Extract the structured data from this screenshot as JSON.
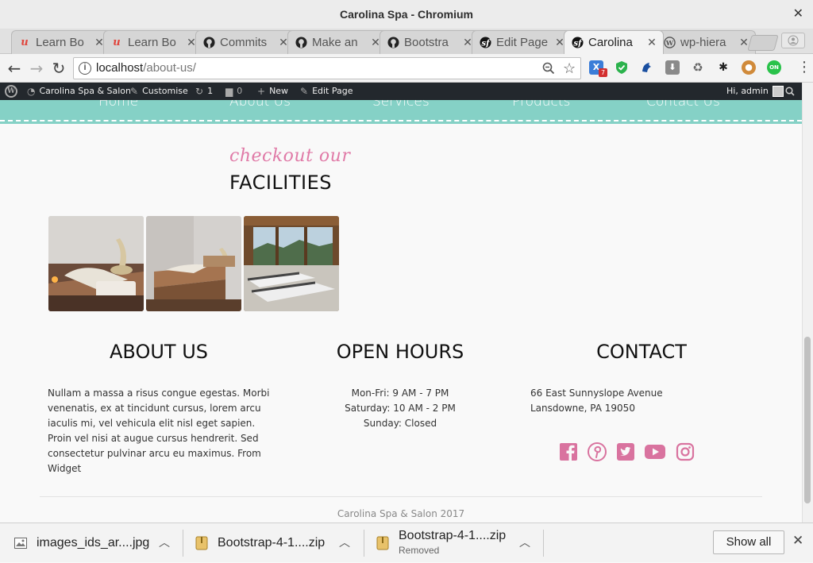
{
  "window": {
    "title": "Carolina Spa - Chromium",
    "close_glyph": "✕"
  },
  "tabs": [
    {
      "label": "Learn Bo",
      "icon": "udemy-icon"
    },
    {
      "label": "Learn Bo",
      "icon": "udemy-icon"
    },
    {
      "label": "Commits",
      "icon": "github-icon"
    },
    {
      "label": "Make an",
      "icon": "github-icon"
    },
    {
      "label": "Bootstra",
      "icon": "github-icon"
    },
    {
      "label": "Edit Page",
      "icon": "symfony-icon"
    },
    {
      "label": "Carolina",
      "icon": "symfony-icon",
      "active": true
    },
    {
      "label": "wp-hiera",
      "icon": "wordpress-icon"
    }
  ],
  "tab_close_glyph": "✕",
  "toolbar": {
    "url_host": "localhost",
    "url_path": "/about-us/",
    "ext_badge": "7"
  },
  "adminbar": {
    "site_name": "Carolina Spa & Salon",
    "customise": "Customise",
    "updates": "1",
    "comments": "0",
    "new": "New",
    "edit_page": "Edit Page",
    "greeting": "Hi, admin"
  },
  "nav": [
    "Home",
    "About Us",
    "Services",
    "Products",
    "Contact Us"
  ],
  "facilities": {
    "script_heading": "checkout our",
    "heading": "FACILITIES"
  },
  "about": {
    "heading": "ABOUT US",
    "text": "Nullam a massa a risus congue egestas. Morbi venenatis, ex at tincidunt cursus, lorem arcu iaculis mi, vel vehicula elit nisl eget sapien. Proin vel nisi at augue cursus hendrerit. Sed consectetur pulvinar arcu eu maximus. From Widget"
  },
  "hours": {
    "heading": "OPEN HOURS",
    "lines": [
      "Mon-Fri: 9 AM - 7 PM",
      "Saturday: 10 AM - 2 PM",
      "Sunday: Closed"
    ]
  },
  "contact": {
    "heading": "CONTACT",
    "address1": "66 East Sunnyslope Avenue",
    "address2": "Lansdowne, PA 19050",
    "social": [
      "facebook-icon",
      "pinterest-icon",
      "twitter-icon",
      "youtube-icon",
      "instagram-icon"
    ],
    "social_color": "#d9739f"
  },
  "footer": {
    "text": "Carolina Spa & Salon 2017"
  },
  "colors": {
    "nav_bg": "#85d1c6",
    "accent_pink": "#e07aa7",
    "adminbar_bg": "#23282d"
  },
  "downloads": {
    "items": [
      {
        "name": "images_ids_ar....jpg",
        "status": ""
      },
      {
        "name": "Bootstrap-4-1....zip",
        "status": ""
      },
      {
        "name": "Bootstrap-4-1....zip",
        "status": "Removed"
      }
    ],
    "show_all": "Show all",
    "close_glyph": "✕"
  }
}
